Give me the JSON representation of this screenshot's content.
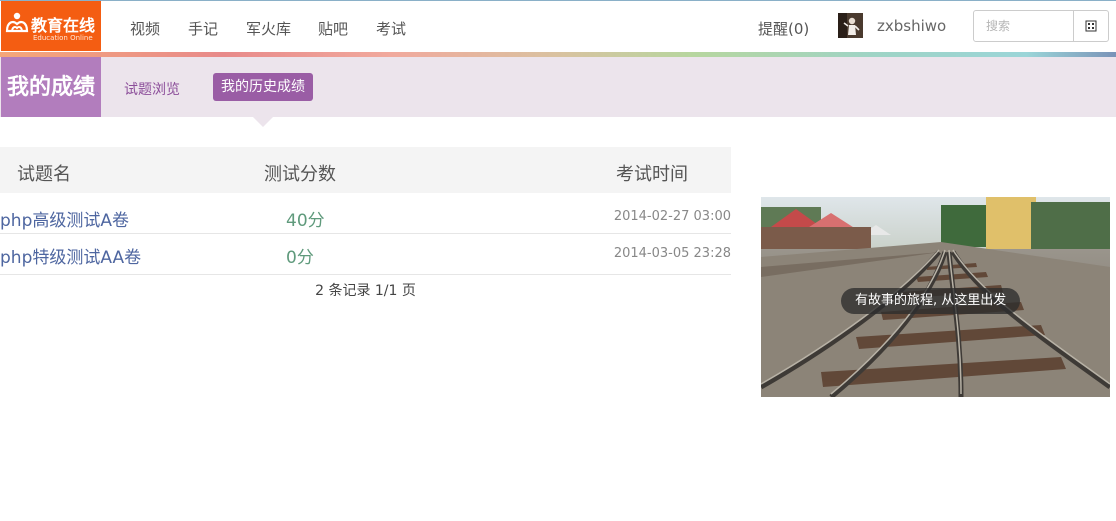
{
  "logo": {
    "name": "教育在线",
    "subtitle": "Education Online"
  },
  "nav": {
    "items": [
      "视频",
      "手记",
      "军火库",
      "贴吧",
      "考试"
    ]
  },
  "user": {
    "reminder": "提醒(0)",
    "username": "zxbshiwo"
  },
  "search": {
    "placeholder": "搜索"
  },
  "section": {
    "title": "我的成绩",
    "tabs": [
      {
        "label": "试题浏览",
        "active": false
      },
      {
        "label": "我的历史成绩",
        "active": true
      }
    ]
  },
  "table": {
    "headers": {
      "name": "试题名",
      "score": "测试分数",
      "time": "考试时间"
    },
    "rows": [
      {
        "name": "php高级测试A卷",
        "score": "40分",
        "time": "2014-02-27 03:00"
      },
      {
        "name": "php特级测试AA卷",
        "score": "0分",
        "time": "2014-03-05 23:28"
      }
    ],
    "pager": "2 条记录 1/1 页"
  },
  "banner": {
    "caption": "有故事的旅程, 从这里出发"
  },
  "colors": {
    "logo_bg": "#f45d12",
    "section_title_bg": "#b27dbd",
    "subbar_bg": "#ece4ec",
    "active_tab_bg": "#9a5da5",
    "link": "#4e66a0",
    "score": "#5f9a7c"
  }
}
